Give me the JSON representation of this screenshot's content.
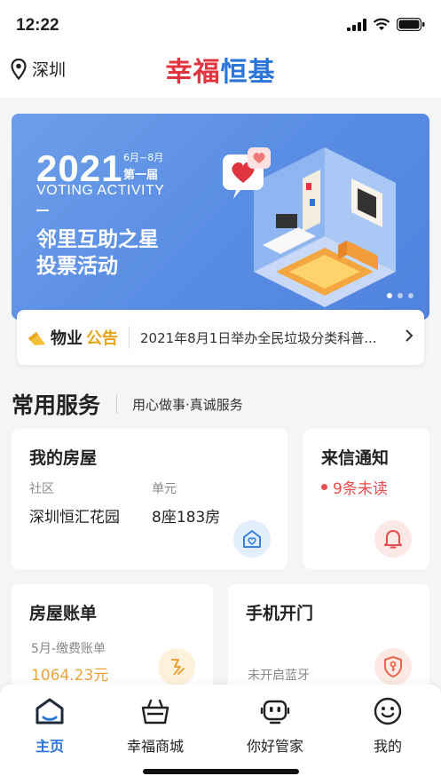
{
  "status": {
    "time": "12:22"
  },
  "header": {
    "city": "深圳",
    "brand_part1": "幸福",
    "brand_part2": "恒基"
  },
  "banner": {
    "year": "2021",
    "dates": "6月~8月",
    "edition": "第一届",
    "subtitle": "VOTING ACTIVITY",
    "title_line1": "邻里互助之星",
    "title_line2": "投票活动"
  },
  "notice": {
    "tag_part1": "物业",
    "tag_part2": "公告",
    "message": "2021年8月1日举办全民垃圾分类科普..."
  },
  "services": {
    "heading": "常用服务",
    "slogan": "用心做事·真诚服务",
    "my_house": {
      "title": "我的房屋",
      "community_label": "社区",
      "community_value": "深圳恒汇花园",
      "unit_label": "单元",
      "unit_value": "8座183房"
    },
    "messages": {
      "title": "来信通知",
      "unread": "9条未读"
    },
    "bill": {
      "title": "房屋账单",
      "label": "5月-缴费账单",
      "amount": "1064.23元"
    },
    "door": {
      "title": "手机开门",
      "status": "未开启蓝牙"
    }
  },
  "tabs": [
    {
      "label": "主页",
      "icon": "home-icon"
    },
    {
      "label": "幸福商城",
      "icon": "basket-icon"
    },
    {
      "label": "你好管家",
      "icon": "robot-icon"
    },
    {
      "label": "我的",
      "icon": "smile-icon"
    }
  ],
  "colors": {
    "accent": "#2b74d8",
    "brand_red": "#e0353e",
    "unread_red": "#e84c4c",
    "amount_orange": "#f0a33a"
  }
}
